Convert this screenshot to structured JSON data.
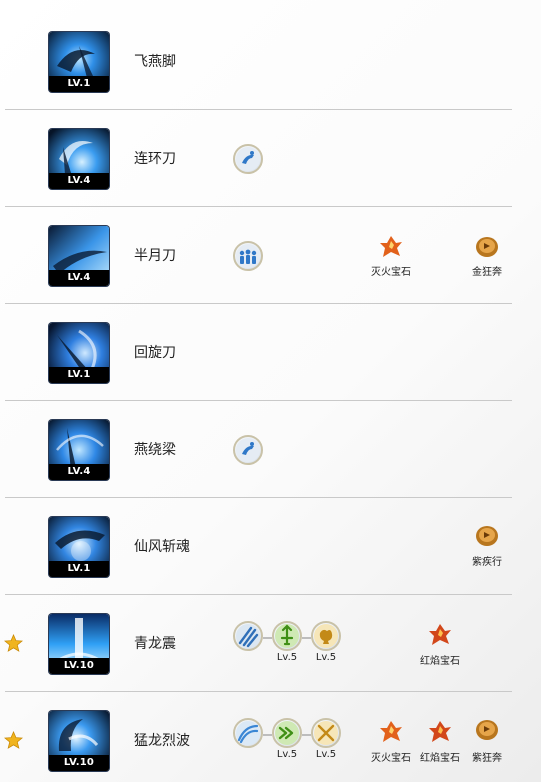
{
  "skills": [
    {
      "name": "飞燕脚",
      "level": "LV.1",
      "star": false
    },
    {
      "name": "连环刀",
      "level": "LV.4",
      "star": false
    },
    {
      "name": "半月刀",
      "level": "LV.4",
      "star": false
    },
    {
      "name": "回旋刀",
      "level": "LV.1",
      "star": false
    },
    {
      "name": "燕绕梁",
      "level": "LV.4",
      "star": false
    },
    {
      "name": "仙风斩魂",
      "level": "LV.1",
      "star": false
    },
    {
      "name": "青龙震",
      "level": "LV.10",
      "star": true
    },
    {
      "name": "猛龙烈波",
      "level": "LV.10",
      "star": true
    }
  ],
  "mods": {
    "r1": [
      {
        "icon": "runner-icon"
      }
    ],
    "r2": [
      {
        "icon": "group-icon"
      }
    ],
    "r4": [
      {
        "icon": "runner-icon"
      }
    ],
    "r6": [
      {
        "icon": "claw-icon"
      },
      {
        "icon": "sword-up-icon",
        "level": "Lv.5"
      },
      {
        "icon": "fist-icon",
        "level": "Lv.5"
      }
    ],
    "r7": [
      {
        "icon": "wave-icon"
      },
      {
        "icon": "arrows-icon",
        "level": "Lv.5"
      },
      {
        "icon": "crossed-swords-icon",
        "level": "Lv.5"
      }
    ]
  },
  "gems": {
    "r2": [
      {
        "label": "灭火宝石",
        "type": "fire"
      },
      {
        "label": "金狂奔",
        "type": "rune"
      }
    ],
    "r5": [
      {
        "label": "紫疾行",
        "type": "rune"
      }
    ],
    "r6": [
      {
        "label": "红焰宝石",
        "type": "fire"
      }
    ],
    "r7": [
      {
        "label": "灭火宝石",
        "type": "fire"
      },
      {
        "label": "红焰宝石",
        "type": "fire"
      },
      {
        "label": "紫狂奔",
        "type": "rune"
      }
    ]
  },
  "colors": {
    "divider": "#c9c9c9",
    "badge_bg": "#000000",
    "skill_glow": "#3fa9ff"
  }
}
